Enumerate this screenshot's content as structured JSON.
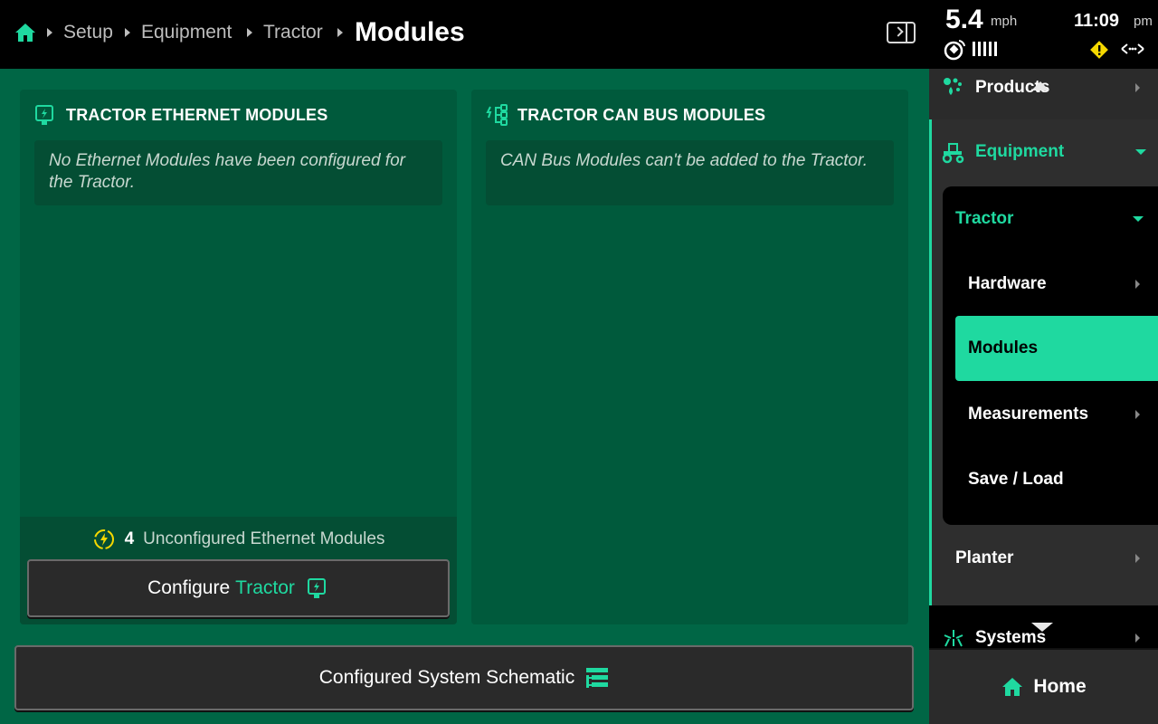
{
  "header": {
    "breadcrumbs": [
      "Setup",
      "Equipment",
      "Tractor"
    ],
    "current": "Modules"
  },
  "status": {
    "speed": "5.4",
    "speed_unit": "mph",
    "time": "11:09",
    "ampm": "pm"
  },
  "ethernet_card": {
    "title": "TRACTOR ETHERNET MODULES",
    "note": "No Ethernet Modules have been configured for the Tractor.",
    "unconfigured_count": "4",
    "unconfigured_label": "Unconfigured Ethernet Modules",
    "configure_label": "Configure",
    "configure_target": "Tractor"
  },
  "can_card": {
    "title": "TRACTOR CAN BUS MODULES",
    "note": "CAN Bus Modules can't be added to the Tractor."
  },
  "schematic_button": "Configured System Schematic",
  "sidebar": {
    "products": "Products",
    "equipment": "Equipment",
    "tractor": "Tractor",
    "hardware": "Hardware",
    "modules": "Modules",
    "measurements": "Measurements",
    "save_load": "Save / Load",
    "planter": "Planter",
    "systems": "Systems",
    "home": "Home"
  },
  "colors": {
    "accent": "#1fd9a0",
    "background_green": "#006645",
    "warning": "#f5d800"
  }
}
